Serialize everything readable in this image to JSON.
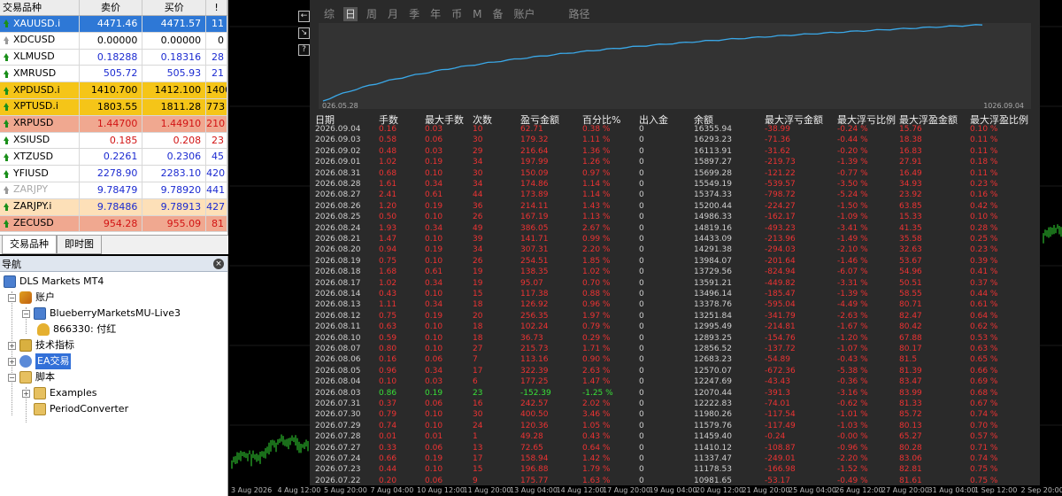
{
  "market_watch": {
    "headers": {
      "symbol": "交易品种",
      "bid": "卖价",
      "ask": "买价",
      "spread": "!"
    },
    "rows": [
      {
        "symbol": "XAUUSD.i",
        "bid": "4471.46",
        "ask": "4471.57",
        "spread": "11",
        "bg": "#2e78d6",
        "fg": "#ffffff",
        "arrow": "green"
      },
      {
        "symbol": "XDCUSD",
        "bid": "0.00000",
        "ask": "0.00000",
        "spread": "0",
        "bg": "#ffffff",
        "fg": "#000000",
        "arrow": "grey"
      },
      {
        "symbol": "XLMUSD",
        "bid": "0.18288",
        "ask": "0.18316",
        "spread": "28",
        "bg": "#ffffff",
        "fg": "#1c2bd1",
        "arrow": "green"
      },
      {
        "symbol": "XMRUSD",
        "bid": "505.72",
        "ask": "505.93",
        "spread": "21",
        "bg": "#ffffff",
        "fg": "#1c2bd1",
        "arrow": "green"
      },
      {
        "symbol": "XPDUSD.i",
        "bid": "1410.700",
        "ask": "1412.100",
        "spread": "1400",
        "bg": "#f5c518",
        "fg": "#000000",
        "arrow": "green"
      },
      {
        "symbol": "XPTUSD.i",
        "bid": "1803.55",
        "ask": "1811.28",
        "spread": "773",
        "bg": "#f5c518",
        "fg": "#000000",
        "arrow": "green"
      },
      {
        "symbol": "XRPUSD",
        "bid": "1.44700",
        "ask": "1.44910",
        "spread": "210",
        "bg": "#f0a890",
        "fg": "#d21414",
        "arrow": "green"
      },
      {
        "symbol": "XSIUSD",
        "bid": "0.185",
        "ask": "0.208",
        "spread": "23",
        "bg": "#ffffff",
        "fg": "#d21414",
        "arrow": "green"
      },
      {
        "symbol": "XTZUSD",
        "bid": "0.2261",
        "ask": "0.2306",
        "spread": "45",
        "bg": "#ffffff",
        "fg": "#1c2bd1",
        "arrow": "green"
      },
      {
        "symbol": "YFIUSD",
        "bid": "2278.90",
        "ask": "2283.10",
        "spread": "420",
        "bg": "#ffffff",
        "fg": "#1c2bd1",
        "arrow": "green"
      },
      {
        "symbol": "ZARJPY",
        "bid": "9.78479",
        "ask": "9.78920",
        "spread": "441",
        "bg": "#ffffff",
        "fg": "#1c2bd1",
        "arrow": "grey"
      },
      {
        "symbol": "ZARJPY.i",
        "bid": "9.78486",
        "ask": "9.78913",
        "spread": "427",
        "bg": "#fde0b8",
        "fg": "#1c2bd1",
        "arrow": "green"
      },
      {
        "symbol": "ZECUSD",
        "bid": "954.28",
        "ask": "955.09",
        "spread": "81",
        "bg": "#f0a890",
        "fg": "#d21414",
        "arrow": "green"
      }
    ],
    "tabs": [
      "交易品种",
      "即时图"
    ]
  },
  "navigator": {
    "title": "导航",
    "items": {
      "root": "DLS Markets MT4",
      "accounts": "账户",
      "server": "BlueberryMarketsMU-Live3",
      "account": "866330: 付红",
      "indicators": "技术指标",
      "ea": "EA交易",
      "scripts": "脚本",
      "examples": "Examples",
      "period_converter": "PeriodConverter"
    }
  },
  "stats_panel": {
    "tabs": [
      "综",
      "日",
      "周",
      "月",
      "季",
      "年",
      "币",
      "M",
      "备",
      "账户",
      "路径"
    ],
    "active_tab": "日",
    "equity_start": "026.05.28",
    "equity_end": "1026.09.04",
    "headers": [
      "日期",
      "手数",
      "最大手数",
      "次数",
      "盈亏金额",
      "百分比%",
      "出入金",
      "余额",
      "最大浮亏金额",
      "最大浮亏比例",
      "最大浮盈金额",
      "最大浮盈比例"
    ],
    "rows": [
      [
        "2026.09.04",
        "0.16",
        "0.03",
        "10",
        "62.71",
        "0.38 %",
        "0",
        "16355.94",
        "-38.99",
        "-0.24 %",
        "15.76",
        "0.10 %"
      ],
      [
        "2026.09.03",
        "0.58",
        "0.06",
        "30",
        "179.32",
        "1.11 %",
        "0",
        "16293.23",
        "-71.36",
        "-0.44 %",
        "18.38",
        "0.11 %"
      ],
      [
        "2026.09.02",
        "0.48",
        "0.03",
        "29",
        "216.64",
        "1.36 %",
        "0",
        "16113.91",
        "-31.62",
        "-0.20 %",
        "16.83",
        "0.11 %"
      ],
      [
        "2026.09.01",
        "1.02",
        "0.19",
        "34",
        "197.99",
        "1.26 %",
        "0",
        "15897.27",
        "-219.73",
        "-1.39 %",
        "27.91",
        "0.18 %"
      ],
      [
        "2026.08.31",
        "0.68",
        "0.10",
        "30",
        "150.09",
        "0.97 %",
        "0",
        "15699.28",
        "-121.22",
        "-0.77 %",
        "16.49",
        "0.11 %"
      ],
      [
        "2026.08.28",
        "1.61",
        "0.34",
        "34",
        "174.86",
        "1.14 %",
        "0",
        "15549.19",
        "-539.57",
        "-3.50 %",
        "34.93",
        "0.23 %"
      ],
      [
        "2026.08.27",
        "2.41",
        "0.61",
        "44",
        "173.89",
        "1.14 %",
        "0",
        "15374.33",
        "-798.72",
        "-5.24 %",
        "23.92",
        "0.16 %"
      ],
      [
        "2026.08.26",
        "1.20",
        "0.19",
        "36",
        "214.11",
        "1.43 %",
        "0",
        "15200.44",
        "-224.27",
        "-1.50 %",
        "63.85",
        "0.42 %"
      ],
      [
        "2026.08.25",
        "0.50",
        "0.10",
        "26",
        "167.19",
        "1.13 %",
        "0",
        "14986.33",
        "-162.17",
        "-1.09 %",
        "15.33",
        "0.10 %"
      ],
      [
        "2026.08.24",
        "1.93",
        "0.34",
        "49",
        "386.05",
        "2.67 %",
        "0",
        "14819.16",
        "-493.23",
        "-3.41 %",
        "41.35",
        "0.28 %"
      ],
      [
        "2026.08.21",
        "1.47",
        "0.10",
        "39",
        "141.71",
        "0.99 %",
        "0",
        "14433.09",
        "-213.96",
        "-1.49 %",
        "35.58",
        "0.25 %"
      ],
      [
        "2026.08.20",
        "0.94",
        "0.19",
        "34",
        "307.31",
        "2.20 %",
        "0",
        "14291.38",
        "-294.03",
        "-2.10 %",
        "32.63",
        "0.23 %"
      ],
      [
        "2026.08.19",
        "0.75",
        "0.10",
        "26",
        "254.51",
        "1.85 %",
        "0",
        "13984.07",
        "-201.64",
        "-1.46 %",
        "53.67",
        "0.39 %"
      ],
      [
        "2026.08.18",
        "1.68",
        "0.61",
        "19",
        "138.35",
        "1.02 %",
        "0",
        "13729.56",
        "-824.94",
        "-6.07 %",
        "54.96",
        "0.41 %"
      ],
      [
        "2026.08.17",
        "1.02",
        "0.34",
        "19",
        "95.07",
        "0.70 %",
        "0",
        "13591.21",
        "-449.82",
        "-3.31 %",
        "50.51",
        "0.37 %"
      ],
      [
        "2026.08.14",
        "0.43",
        "0.10",
        "15",
        "117.38",
        "0.88 %",
        "0",
        "13496.14",
        "-185.47",
        "-1.39 %",
        "58.55",
        "0.44 %"
      ],
      [
        "2026.08.13",
        "1.11",
        "0.34",
        "18",
        "126.92",
        "0.96 %",
        "0",
        "13378.76",
        "-595.04",
        "-4.49 %",
        "80.71",
        "0.61 %"
      ],
      [
        "2026.08.12",
        "0.75",
        "0.19",
        "20",
        "256.35",
        "1.97 %",
        "0",
        "13251.84",
        "-341.79",
        "-2.63 %",
        "82.47",
        "0.64 %"
      ],
      [
        "2026.08.11",
        "0.63",
        "0.10",
        "18",
        "102.24",
        "0.79 %",
        "0",
        "12995.49",
        "-214.81",
        "-1.67 %",
        "80.42",
        "0.62 %"
      ],
      [
        "2026.08.10",
        "0.59",
        "0.10",
        "18",
        "36.73",
        "0.29 %",
        "0",
        "12893.25",
        "-154.76",
        "-1.20 %",
        "67.88",
        "0.53 %"
      ],
      [
        "2026.08.07",
        "0.80",
        "0.10",
        "27",
        "215.73",
        "1.71 %",
        "0",
        "12856.52",
        "-137.72",
        "-1.07 %",
        "80.17",
        "0.63 %"
      ],
      [
        "2026.08.06",
        "0.16",
        "0.06",
        "7",
        "113.16",
        "0.90 %",
        "0",
        "12683.23",
        "-54.89",
        "-0.43 %",
        "81.5",
        "0.65 %"
      ],
      [
        "2026.08.05",
        "0.96",
        "0.34",
        "17",
        "322.39",
        "2.63 %",
        "0",
        "12570.07",
        "-672.36",
        "-5.38 %",
        "81.39",
        "0.66 %"
      ],
      [
        "2026.08.04",
        "0.10",
        "0.03",
        "6",
        "177.25",
        "1.47 %",
        "0",
        "12247.69",
        "-43.43",
        "-0.36 %",
        "83.47",
        "0.69 %"
      ],
      [
        "2026.08.03",
        "0.86",
        "0.19",
        "23",
        "-152.39",
        "-1.25 %",
        "0",
        "12070.44",
        "-391.3",
        "-3.16 %",
        "83.99",
        "0.68 %"
      ],
      [
        "2026.07.31",
        "0.37",
        "0.06",
        "16",
        "242.57",
        "2.02 %",
        "0",
        "12222.83",
        "-74.01",
        "-0.62 %",
        "81.33",
        "0.67 %"
      ],
      [
        "2026.07.30",
        "0.79",
        "0.10",
        "30",
        "400.50",
        "3.46 %",
        "0",
        "11980.26",
        "-117.54",
        "-1.01 %",
        "85.72",
        "0.74 %"
      ],
      [
        "2026.07.29",
        "0.74",
        "0.10",
        "24",
        "120.36",
        "1.05 %",
        "0",
        "11579.76",
        "-117.49",
        "-1.03 %",
        "80.13",
        "0.70 %"
      ],
      [
        "2026.07.28",
        "0.01",
        "0.01",
        "1",
        "49.28",
        "0.43 %",
        "0",
        "11459.40",
        "-0.24",
        "-0.00 %",
        "65.27",
        "0.57 %"
      ],
      [
        "2026.07.27",
        "0.33",
        "0.06",
        "13",
        "72.65",
        "0.64 %",
        "0",
        "11410.12",
        "-108.87",
        "-0.96 %",
        "80.28",
        "0.71 %"
      ],
      [
        "2026.07.24",
        "0.66",
        "0.19",
        "17",
        "158.94",
        "1.42 %",
        "0",
        "11337.47",
        "-249.01",
        "-2.20 %",
        "83.06",
        "0.74 %"
      ],
      [
        "2026.07.23",
        "0.44",
        "0.10",
        "15",
        "196.88",
        "1.79 %",
        "0",
        "11178.53",
        "-166.98",
        "-1.52 %",
        "82.81",
        "0.75 %"
      ],
      [
        "2026.07.22",
        "0.20",
        "0.06",
        "9",
        "175.77",
        "1.63 %",
        "0",
        "10981.65",
        "-53.17",
        "-0.49 %",
        "81.61",
        "0.75 %"
      ]
    ]
  },
  "chart_buttons": [
    "←",
    "↘",
    "?"
  ],
  "time_axis": [
    "3 Aug 2026",
    "4 Aug 12:00",
    "5 Aug 20:00",
    "7 Aug 04:00",
    "10 Aug 12:00",
    "11 Aug 20:00",
    "13 Aug 04:00",
    "14 Aug 12:00",
    "17 Aug 20:00",
    "19 Aug 04:00",
    "20 Aug 12:00",
    "21 Aug 20:00",
    "25 Aug 04:00",
    "26 Aug 12:00",
    "27 Aug 20:00",
    "31 Aug 04:00",
    "1 Sep 12:00",
    "2 Sep 20:00"
  ]
}
